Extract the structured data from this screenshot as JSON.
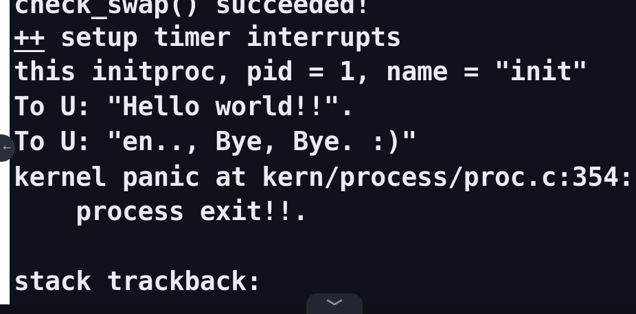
{
  "terminal": {
    "lines": [
      "check_swap() succeeded!",
      " setup timer interrupts",
      "this initproc, pid = 1, name = \"init\"",
      "To U: \"Hello world!!\".",
      "To U: \"en.., Bye, Bye. :)\"",
      "kernel panic at kern/process/proc.c:354:",
      "    process exit!!.",
      "",
      "stack trackback:"
    ],
    "prefix_marker": "++"
  },
  "icons": {
    "scroll_left": "arrow-left-icon",
    "bottom_handle": "chevron-down-icon"
  },
  "colors": {
    "background": "#0f121b",
    "text": "#e9ecf2",
    "gutter": "#ffffff"
  }
}
